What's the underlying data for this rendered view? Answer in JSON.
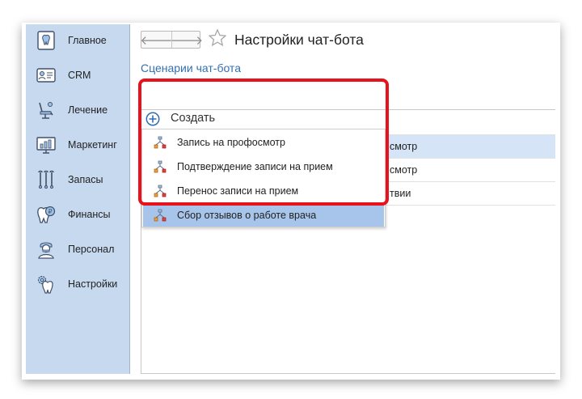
{
  "sidebar": {
    "items": [
      {
        "label": "Главное",
        "icon": "tooth-home-icon"
      },
      {
        "label": "CRM",
        "icon": "contact-card-icon"
      },
      {
        "label": "Лечение",
        "icon": "dental-chair-icon"
      },
      {
        "label": "Маркетинг",
        "icon": "chart-monitor-icon"
      },
      {
        "label": "Запасы",
        "icon": "dental-tools-icon"
      },
      {
        "label": "Финансы",
        "icon": "tooth-coin-icon"
      },
      {
        "label": "Персонал",
        "icon": "doctor-icon"
      },
      {
        "label": "Настройки",
        "icon": "tooth-gear-icon"
      }
    ]
  },
  "header": {
    "back_glyph": "🡐",
    "forward_glyph": "🡒",
    "title": "Настройки чат-бота"
  },
  "section_link": "Сценарии чат-бота",
  "create": {
    "label": "Создать"
  },
  "menu": {
    "items": [
      {
        "label": "Запись на профосмотр",
        "selected": false
      },
      {
        "label": "Подтверждение записи на прием",
        "selected": false
      },
      {
        "label": "Перенос записи на прием",
        "selected": false
      },
      {
        "label": "Сбор отзывов о работе врача",
        "selected": true
      }
    ]
  },
  "table": {
    "rows": [
      {
        "text": "смотр"
      },
      {
        "text": "смотр"
      },
      {
        "text": "твии"
      }
    ]
  },
  "colors": {
    "sidebar_bg": "#c7d9ef",
    "link": "#3170b3",
    "selected_row": "#a7c5ea",
    "highlight": "#e8121c"
  }
}
